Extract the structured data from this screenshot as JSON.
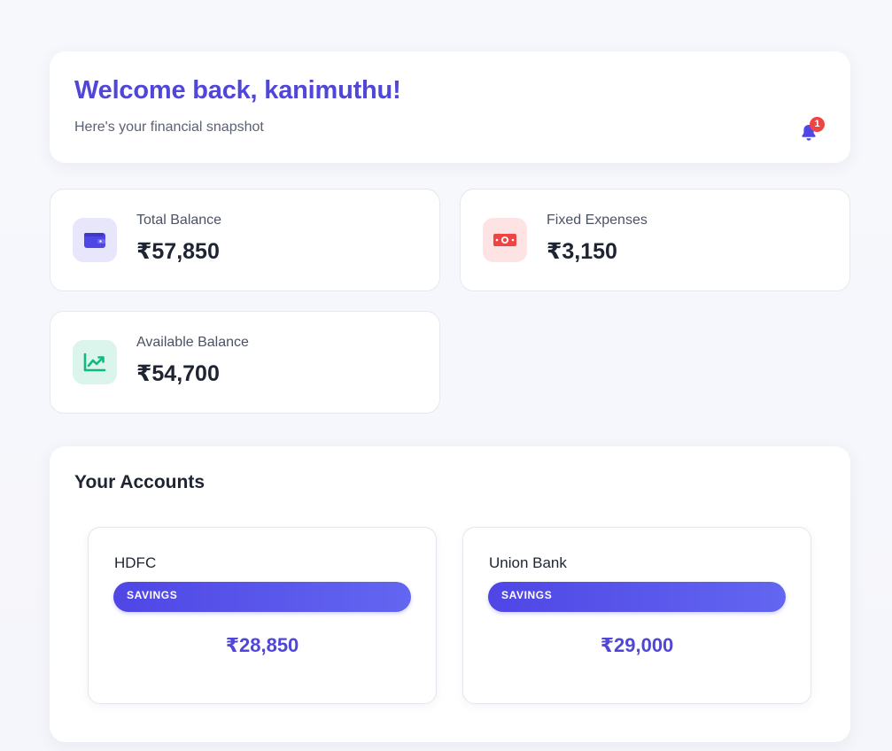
{
  "header": {
    "welcome": "Welcome back, kanimuthu!",
    "subtitle": "Here's your financial snapshot",
    "notification_count": "1"
  },
  "stats": [
    {
      "label": "Total Balance",
      "value": "₹57,850",
      "icon": "wallet-icon",
      "icon_color": "#4f46e5",
      "icon_bg": "#e7e6fb"
    },
    {
      "label": "Fixed Expenses",
      "value": "₹3,150",
      "icon": "money-bill-icon",
      "icon_color": "#ef4444",
      "icon_bg": "#fde3e3"
    },
    {
      "label": "Available Balance",
      "value": "₹54,700",
      "icon": "chart-line-icon",
      "icon_color": "#10b981",
      "icon_bg": "#dcf5ec"
    }
  ],
  "accounts": {
    "title": "Your Accounts",
    "items": [
      {
        "bank": "HDFC",
        "type": "SAVINGS",
        "balance": "₹28,850"
      },
      {
        "bank": "Union Bank",
        "type": "SAVINGS",
        "balance": "₹29,000"
      }
    ]
  },
  "colors": {
    "accent": "#5046d8",
    "badge": "#ef4444"
  }
}
